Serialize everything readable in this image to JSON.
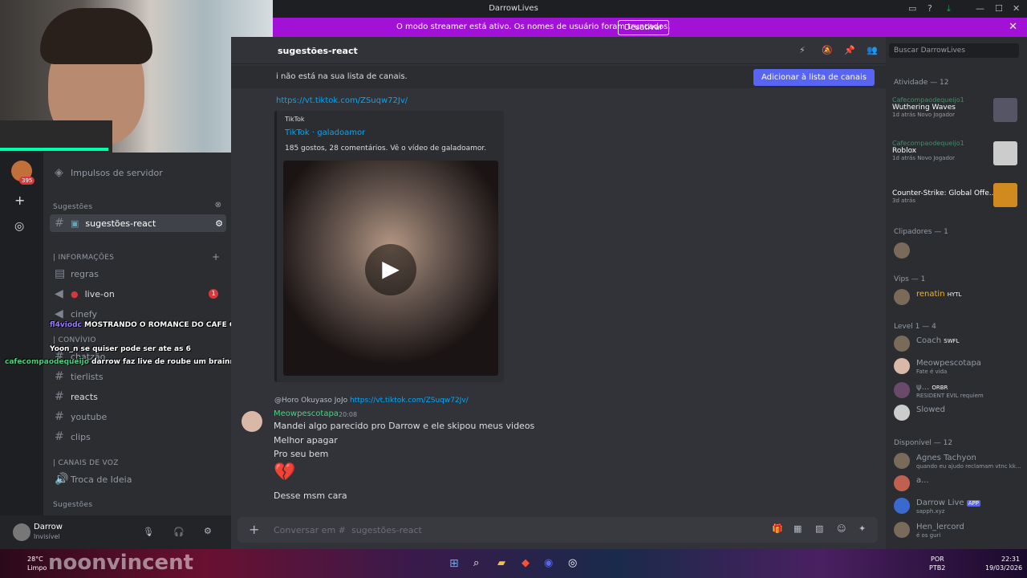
{
  "titlebar": {
    "title": "DarrowLives"
  },
  "banner": {
    "text": "O modo streamer está ativo. Os nomes de usuário foram truncados.",
    "button": "Desativar"
  },
  "guilds": {
    "badge": "395"
  },
  "sidebar": {
    "boost": "Impulsos de servidor",
    "suggestions_cat": "Sugestões",
    "selected_channel": "sugestões-react",
    "cat_info": "| INFORMAÇÕES",
    "regras": "regras",
    "live_on": "live-on",
    "live_badge": "1",
    "cinefy": "cinefy",
    "cat_convivio": "| CONVÍVIO",
    "chatzao": "chatzão",
    "tierlists": "tierlists",
    "reacts": "reacts",
    "youtube": "youtube",
    "clips": "clips",
    "cat_voice": "| CANAIS DE VOZ",
    "troca": "Troca de Ideia",
    "suggestions2": "Sugestões"
  },
  "user": {
    "name": "Darrow",
    "status": "Invisível"
  },
  "channel": {
    "name": "sugestões-react",
    "search_placeholder": "Buscar DarrowLives"
  },
  "notice": {
    "text": "i não está na sua lista de canais.",
    "button": "Adicionar à lista de canais"
  },
  "messages": {
    "top_link": "https://vt.tiktok.com/ZSuqw72Jv/",
    "embed_provider": "TikTok",
    "embed_title": "TikTok · galadoamor",
    "embed_desc": "185 gostos, 28 comentários. Vê o vídeo de galadoamor.",
    "reply_author": "@Horo Okuyaso",
    "reply_tag": "JoJo",
    "reply_link": "https://vt.tiktok.com/ZSuqw72Jv/",
    "author": "Meowpescotapa",
    "time": "20:08",
    "line1": "Mandei algo parecido pro Darrow e ele skipou meus videos",
    "line2": "Melhor apagar",
    "line3": "Pro seu bem",
    "emoji": "💔",
    "line4": "Desse msm cara"
  },
  "composer": {
    "placeholder": "Conversar em #",
    "channel": "sugestões-react"
  },
  "members": {
    "activity_hdr": "Atividade — 12",
    "activities": [
      {
        "user": "Cafecompaodequeijo1",
        "game": "Wuthering Waves",
        "meta": "1d atrás  Novo Jogador"
      },
      {
        "user": "Cafecompaodequeijo1",
        "game": "Roblox",
        "meta": "1d atrás  Novo Jogador"
      },
      {
        "user": "",
        "game": "Counter-Strike: Global Offe...",
        "meta": "3d atrás"
      }
    ],
    "clip_hdr": "Clipadores — 1",
    "vips_hdr": "Vips — 1",
    "vip": {
      "name": "renatin",
      "tag": "HYTL"
    },
    "level_hdr": "Level 1 — 4",
    "level": [
      {
        "name": "Coach",
        "tag": "SWFL",
        "status": ""
      },
      {
        "name": "Meowpescotapa",
        "tag": "",
        "status": "Fate é vida"
      },
      {
        "name": "ψ...",
        "tag": "ORBR",
        "status": "RESIDENT EVIL requiem"
      },
      {
        "name": "Slowed",
        "tag": "",
        "status": ""
      }
    ],
    "avail_hdr": "Disponível — 12",
    "avail": [
      {
        "name": "Agnes Tachyon",
        "tag": "",
        "status": "quando eu ajudo reclamam vtnc kk..."
      },
      {
        "name": "a...",
        "tag": "",
        "status": ""
      },
      {
        "name": "Darrow Live",
        "tag": "APP",
        "status": "sapph.xyz"
      },
      {
        "name": "Hen_lercord",
        "tag": "",
        "status": "é os guri"
      }
    ]
  },
  "overlay_chat": [
    {
      "user": "fl4viodc",
      "text": "MOSTRANDO O ROMANCE DO CAFE COM O MEOW"
    },
    {
      "user": "Yoon_n",
      "text": "se quiser pode ser ate as 6"
    },
    {
      "user": "cafecompaodequeijo",
      "text": "darrow faz live de roube um brainrot"
    }
  ],
  "taskbar": {
    "weather": "28°C",
    "weather2": "Limpo",
    "brand": "noonvincent",
    "lang": "POR",
    "lang2": "PTB2",
    "time": "22:31",
    "date": "19/03/2026"
  },
  "colors": {
    "accent": "#5865f2",
    "banner": "#a211d6",
    "link": "#00a8fc",
    "vip": "#f0b232"
  }
}
